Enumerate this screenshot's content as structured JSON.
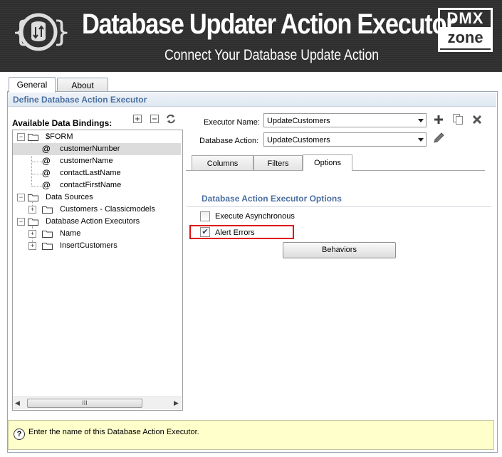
{
  "header": {
    "title": "Database Updater Action Executor",
    "subtitle": "Connect Your Database Update Action",
    "logo_text_top": "DMX",
    "logo_text_bottom": "zone"
  },
  "tabs": [
    {
      "label": "General",
      "active": true
    },
    {
      "label": "About",
      "active": false
    }
  ],
  "section_title": "Define Database Action Executor",
  "bindings": {
    "label": "Available Data Bindings:",
    "tree": {
      "form_label": "$FORM",
      "form_children": [
        "customerNumber",
        "customerName",
        "contactLastName",
        "contactFirstName"
      ],
      "data_sources_label": "Data Sources",
      "data_sources_children": [
        "Customers - Classicmodels"
      ],
      "executors_label": "Database Action Executors",
      "executors_children": [
        "Name",
        "InsertCustomers"
      ]
    },
    "scroll_grip": "III"
  },
  "form": {
    "executor_name_label": "Executor Name:",
    "executor_name_value": "UpdateCustomers",
    "database_action_label": "Database Action:",
    "database_action_value": "UpdateCustomers"
  },
  "subtabs": [
    {
      "label": "Columns"
    },
    {
      "label": "Filters"
    },
    {
      "label": "Options",
      "active": true
    }
  ],
  "options": {
    "title": "Database Action Executor Options",
    "execute_async_label": "Execute Asynchronous",
    "execute_async_checked": false,
    "alert_errors_label": "Alert Errors",
    "alert_errors_checked": true,
    "behaviors_label": "Behaviors"
  },
  "help": {
    "icon": "?",
    "text": "Enter the name of this Database Action Executor."
  },
  "colors": {
    "header_bg": "#2f2f2f",
    "section_title": "#4a6fa1",
    "highlight_border": "#d11111",
    "help_bg": "#ffffcc"
  }
}
